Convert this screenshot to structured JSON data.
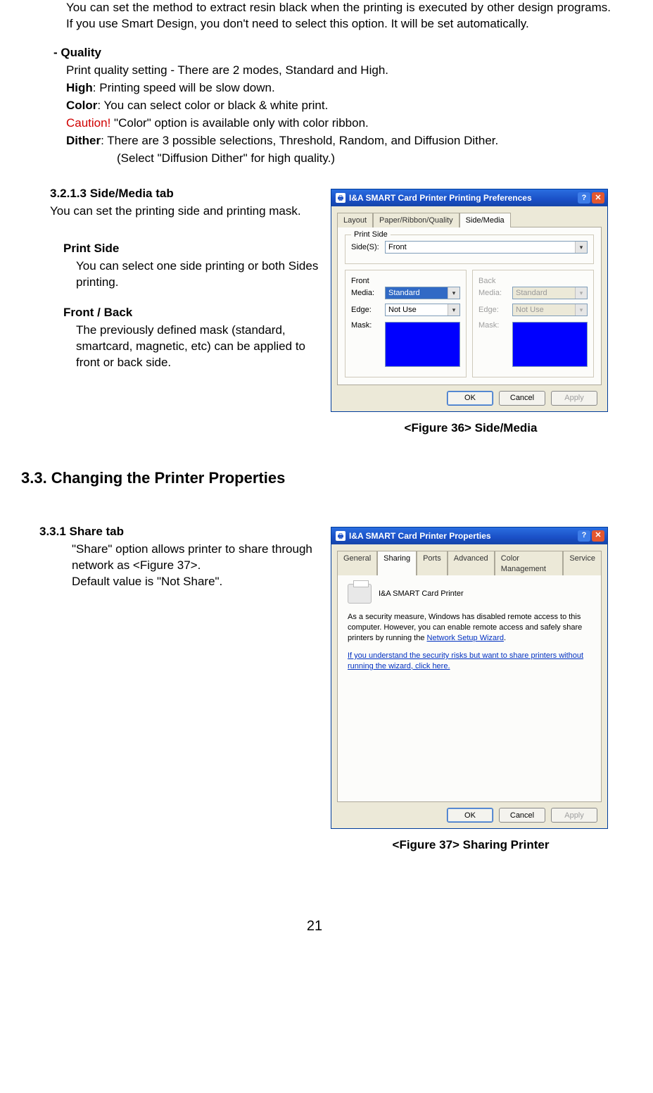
{
  "intro": "You can set the method to extract resin black when the printing is executed by other design programs. If you use Smart Design, you don't need to select this option. It will be set automatically.",
  "quality": {
    "head": "- Quality",
    "l1": "Print quality setting - There are 2 modes, Standard and High.",
    "l2a": "High",
    "l2b": ": Printing speed will be slow down.",
    "l3a": "Color",
    "l3b": ": You can select color or black & white print.",
    "l4a": " Caution!",
    "l4b": " \"Color\" option is available only with color ribbon.",
    "l5a": "Dither",
    "l5b": ": There are 3 possible selections, Threshold, Random, and Diffusion Dither.",
    "l6": "(Select \"Diffusion Dither\" for high quality.)"
  },
  "s3213": {
    "head": "3.2.1.3 Side/Media tab",
    "body": "You can set the printing side and printing mask.",
    "ps_head": "Print Side",
    "ps_body": "You can select one side printing or both Sides printing.",
    "fb_head": "Front / Back",
    "fb_body": "The previously defined mask (standard, smartcard, magnetic, etc) can be applied to front or back side."
  },
  "fig36": {
    "title": "I&A SMART Card Printer Printing Preferences",
    "tabs": {
      "layout": "Layout",
      "paper": "Paper/Ribbon/Quality",
      "side": "Side/Media"
    },
    "grp_printside": "Print Side",
    "side_label": "Side(S):",
    "side_value": "Front",
    "front": "Front",
    "back": "Back",
    "media_lbl": "Media:",
    "edge_lbl": "Edge:",
    "mask_lbl": "Mask:",
    "media_front": "Standard",
    "edge_front": "Not Use",
    "media_back": "Standard",
    "edge_back": "Not Use",
    "ok": "OK",
    "cancel": "Cancel",
    "apply": "Apply",
    "caption": "<Figure 36> Side/Media"
  },
  "h33": "3.3. Changing the Printer Properties",
  "s331": {
    "head": "3.3.1 Share tab",
    "l1": "\"Share\" option allows printer to share through network as <Figure 37>.",
    "l2": "Default value is \"Not Share\"."
  },
  "fig37": {
    "title": "I&A SMART Card Printer Properties",
    "tabs": {
      "general": "General",
      "sharing": "Sharing",
      "ports": "Ports",
      "advanced": "Advanced",
      "color": "Color Management",
      "service": "Service"
    },
    "printer_name": "I&A SMART Card Printer",
    "p1a": "As a security measure, Windows has disabled remote access to this computer. However, you can enable remote access and safely share printers by running the ",
    "p1b": "Network Setup Wizard",
    "p1c": ".",
    "p2": "If you understand the security risks but want to share printers without running the wizard, click here.",
    "ok": "OK",
    "cancel": "Cancel",
    "apply": "Apply",
    "caption": "<Figure 37> Sharing Printer"
  },
  "page_num": "21"
}
